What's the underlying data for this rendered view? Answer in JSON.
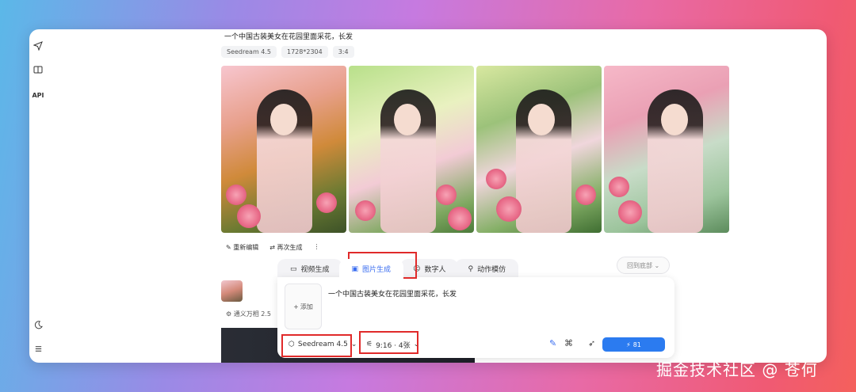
{
  "rail": {
    "icons": [
      "send-icon",
      "book-icon",
      "api-label",
      "moon-icon",
      "menu-icon"
    ],
    "api_label": "API"
  },
  "result": {
    "prompt": "一个中国古装美女在花园里面采花，长发",
    "tags": [
      "Seedream 4.5",
      "1728*2304",
      "3:4"
    ],
    "actions": {
      "edit": "重新编辑",
      "regenerate": "再次生成",
      "more": "⋮"
    }
  },
  "history": {
    "model": "通义万相 2.5"
  },
  "back_bottom": "回到底部",
  "composer": {
    "tabs": [
      "视频生成",
      "图片生成",
      "数字人",
      "动作模仿"
    ],
    "active_tab": 1,
    "add_label": "添加",
    "input_text": "一个中国古装美女在花园里面采花，长发",
    "model_select": "Seedream 4.5",
    "ratio_select": "9:16 · 4张",
    "generate_cost": "81"
  },
  "watermark": "掘金技术社区 @ 苍何"
}
